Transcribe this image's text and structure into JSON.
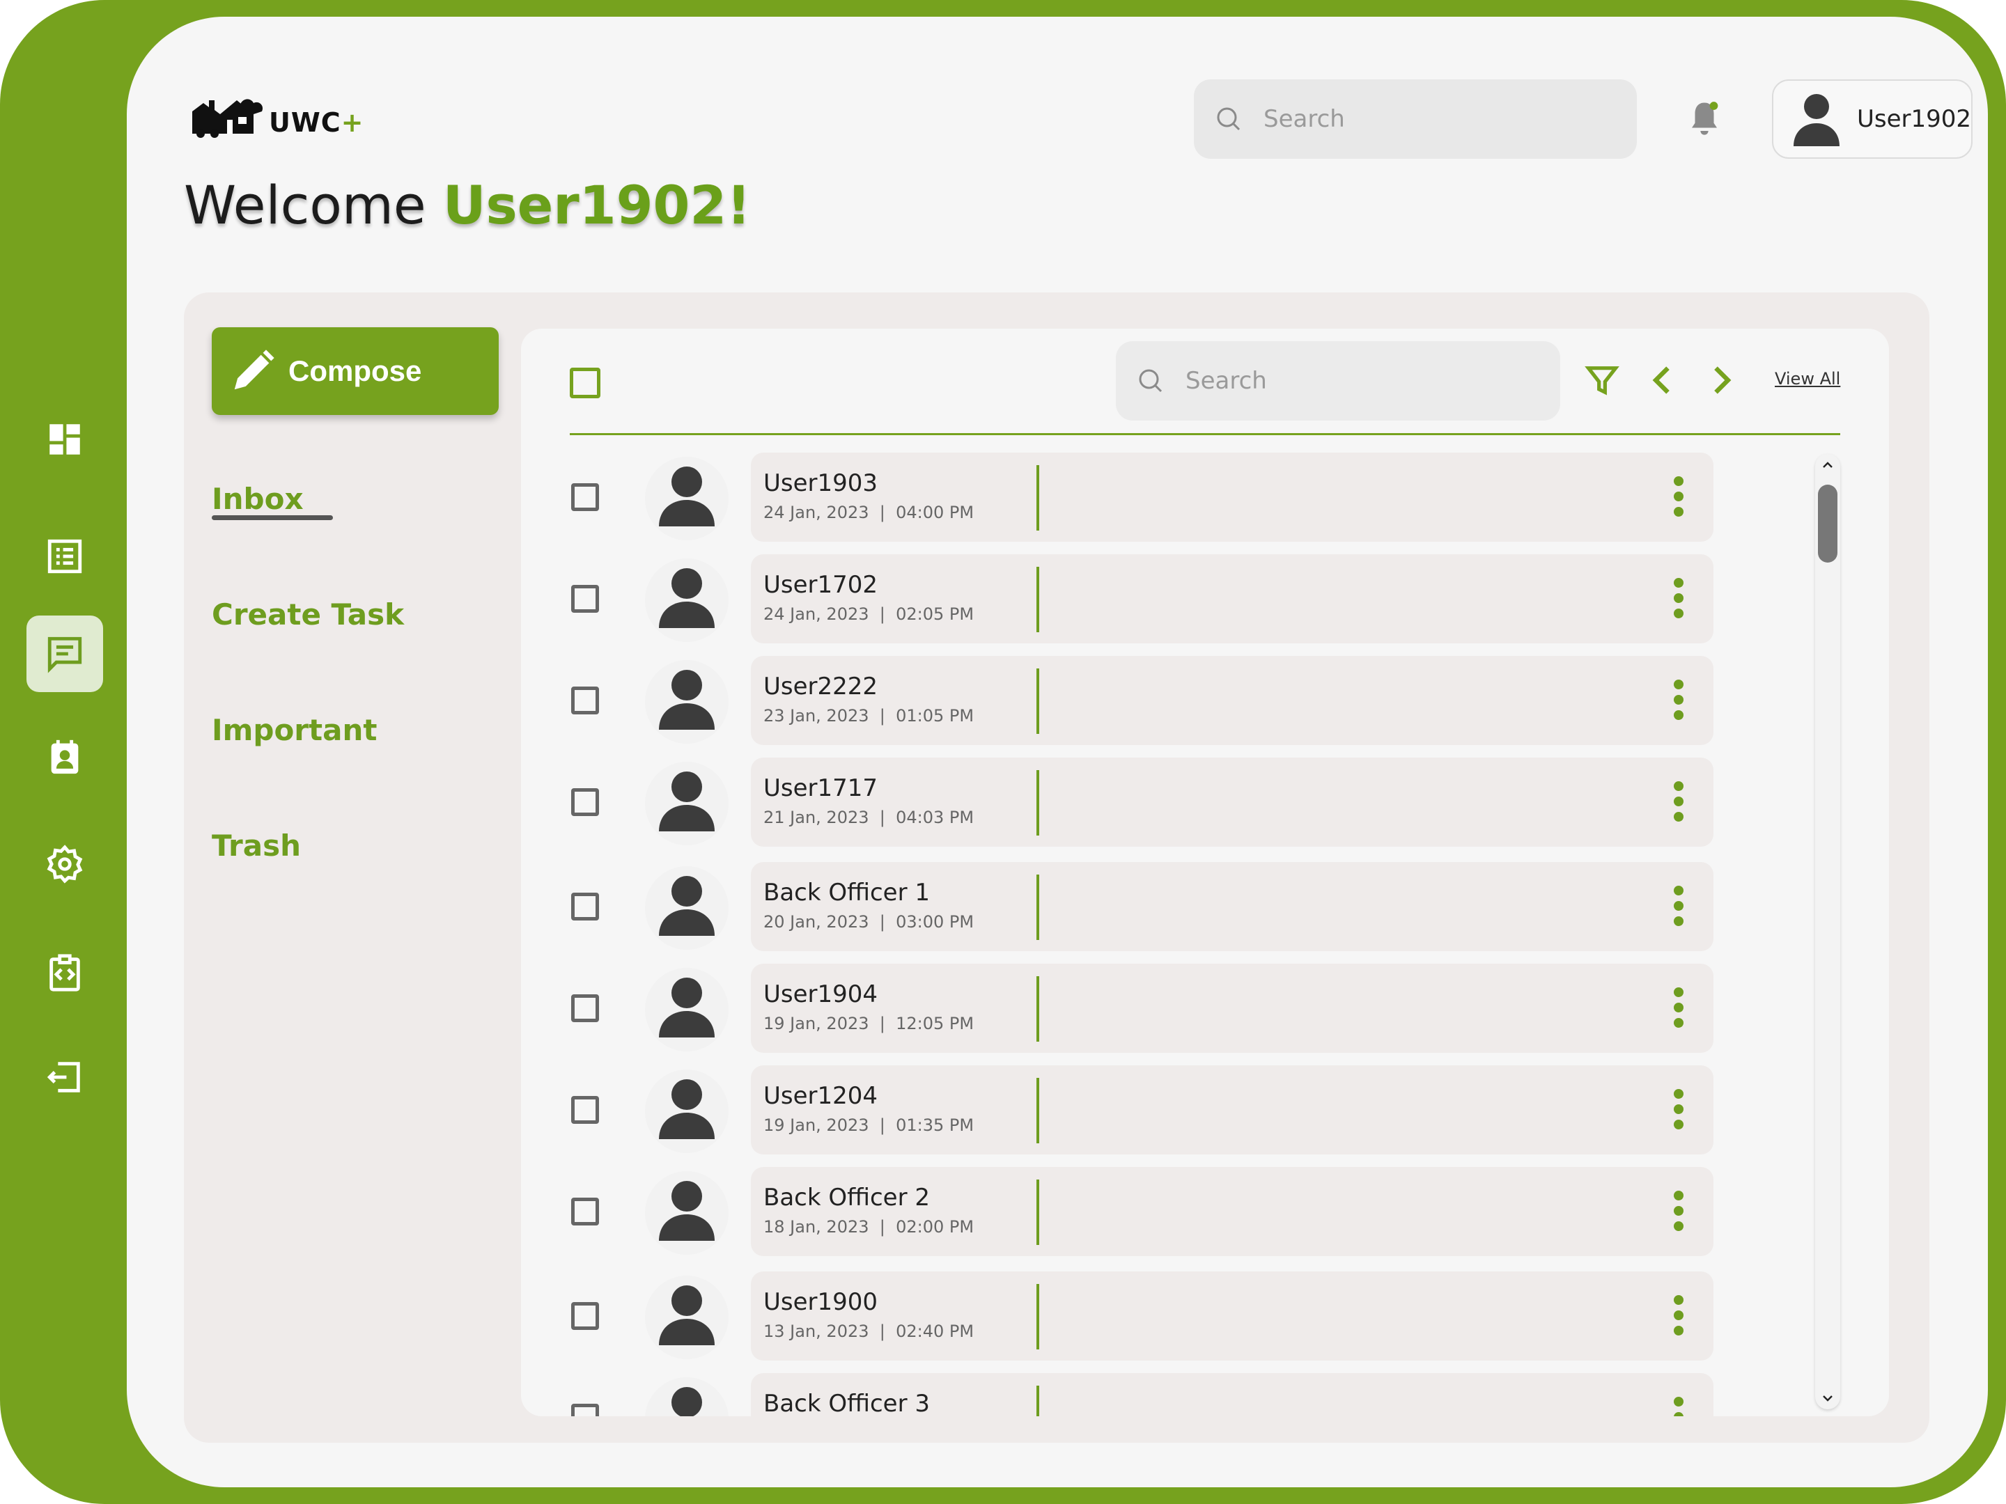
{
  "app": {
    "logo_text": "UWC",
    "logo_plus": "+",
    "welcome_prefix": "Welcome ",
    "welcome_name": "User1902!"
  },
  "header": {
    "search_placeholder": "Search",
    "username": "User1902"
  },
  "sidebar_icons": [
    "dashboard-icon",
    "list-icon",
    "messages-icon",
    "contact-card-icon",
    "settings-icon",
    "code-clipboard-icon",
    "logout-icon"
  ],
  "compose": {
    "label": "Compose"
  },
  "mail_nav": {
    "inbox": "Inbox",
    "create_task": "Create Task",
    "important": "Important",
    "trash": "Trash"
  },
  "mail_toolbar": {
    "search_placeholder": "Search",
    "view_all": "View All"
  },
  "messages": [
    {
      "sender": "User1903",
      "date": "24 Jan, 2023",
      "time": "04:00 PM"
    },
    {
      "sender": "User1702",
      "date": "24 Jan, 2023",
      "time": "02:05 PM"
    },
    {
      "sender": "User2222",
      "date": "23 Jan, 2023",
      "time": "01:05 PM"
    },
    {
      "sender": "User1717",
      "date": "21 Jan, 2023",
      "time": "04:03 PM"
    },
    {
      "sender": "Back Officer 1",
      "date": "20 Jan, 2023",
      "time": "03:00 PM"
    },
    {
      "sender": "User1904",
      "date": "19 Jan, 2023",
      "time": "12:05 PM"
    },
    {
      "sender": "User1204",
      "date": "19 Jan, 2023",
      "time": "01:35 PM"
    },
    {
      "sender": "Back Officer 2",
      "date": "18 Jan, 2023",
      "time": "02:00 PM"
    },
    {
      "sender": "User1900",
      "date": "13 Jan, 2023",
      "time": "02:40 PM"
    },
    {
      "sender": "Back Officer 3",
      "date": "",
      "time": ""
    }
  ],
  "colors": {
    "brand_green": "#76a21e",
    "accent_text_green": "#6aa01a"
  }
}
